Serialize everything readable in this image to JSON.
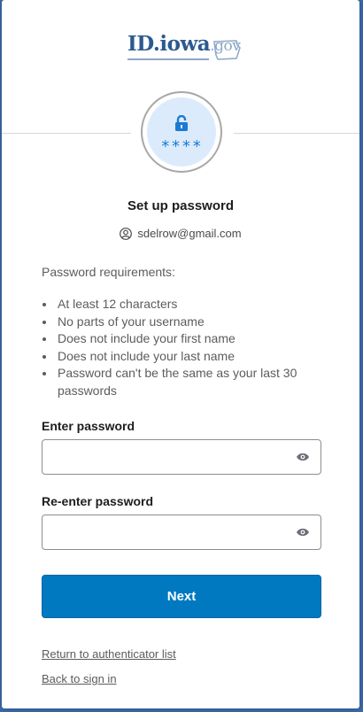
{
  "logo": {
    "main": "ID.iowa",
    "suffix": ".gov"
  },
  "authenticator": {
    "masked": "****"
  },
  "title": "Set up password",
  "user": {
    "email": "sdelrow@gmail.com"
  },
  "requirements": {
    "heading": "Password requirements:",
    "items": [
      "At least 12 characters",
      "No parts of your username",
      "Does not include your first name",
      "Does not include your last name",
      "Password can't be the same as your last 30 passwords"
    ]
  },
  "fields": {
    "password": {
      "label": "Enter password",
      "value": ""
    },
    "confirm": {
      "label": "Re-enter password",
      "value": ""
    }
  },
  "actions": {
    "next_label": "Next"
  },
  "links": {
    "return_label": "Return to authenticator list",
    "back_label": "Back to sign in"
  },
  "colors": {
    "primary": "#0079c1",
    "brand": "#2c5a8f",
    "icon_bg": "#dcebfb",
    "icon_fg": "#1a7bd1"
  }
}
